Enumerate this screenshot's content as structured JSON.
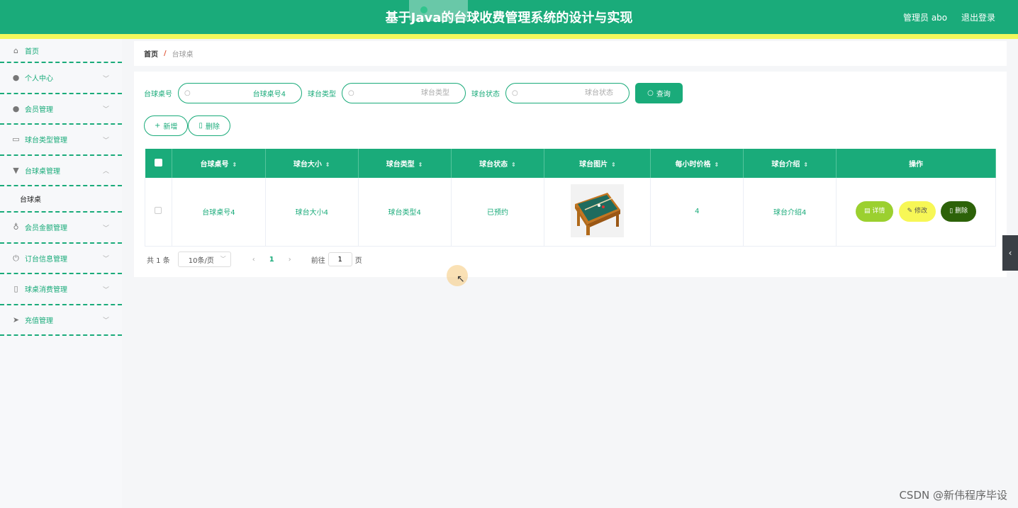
{
  "header": {
    "title": "基于Java的台球收费管理系统的设计与实现",
    "user": "管理员 abo",
    "logout": "退出登录",
    "colors": {
      "primary": "#1aab7a",
      "stripe": "#f2f75c"
    }
  },
  "sidebar": {
    "items": [
      {
        "label": "首页",
        "icon": "home-icon"
      },
      {
        "label": "个人中心",
        "icon": "user-icon"
      },
      {
        "label": "会员管理",
        "icon": "member-icon"
      },
      {
        "label": "球台类型管理",
        "icon": "card-icon"
      },
      {
        "label": "台球桌管理",
        "icon": "flag-icon"
      },
      {
        "label": "会员金额管理",
        "icon": "mic-icon"
      },
      {
        "label": "订台信息管理",
        "icon": "power-icon"
      },
      {
        "label": "球桌消费管理",
        "icon": "bottle-icon"
      },
      {
        "label": "充值管理",
        "icon": "send-icon"
      }
    ],
    "submenu": {
      "label": "台球桌"
    }
  },
  "breadcrumb": {
    "home": "首页",
    "sep": "/",
    "current": "台球桌"
  },
  "search": {
    "fields": [
      {
        "label": "台球桌号",
        "value": "台球桌号4",
        "placeholder": "台球桌号"
      },
      {
        "label": "球台类型",
        "value": "",
        "placeholder": "球台类型"
      },
      {
        "label": "球台状态",
        "value": "",
        "placeholder": "球台状态"
      }
    ],
    "button": "查询"
  },
  "actions": {
    "add": "新增",
    "delete": "删除"
  },
  "table": {
    "headers": [
      "台球桌号",
      "球台大小",
      "球台类型",
      "球台状态",
      "球台图片",
      "每小时价格",
      "球台介绍",
      "操作"
    ],
    "rows": [
      {
        "number": "台球桌号4",
        "size": "球台大小4",
        "type": "球台类型4",
        "status": "已预约",
        "price": "4",
        "intro": "球台介绍4"
      }
    ],
    "ops": {
      "detail": "详情",
      "edit": "修改",
      "delete": "删除"
    }
  },
  "pagination": {
    "total": "共 1 条",
    "page_size": "10条/页",
    "current_page": "1",
    "goto_prefix": "前往",
    "goto_value": "1",
    "goto_suffix": "页"
  },
  "watermark": "CSDN @新伟程序毕设"
}
